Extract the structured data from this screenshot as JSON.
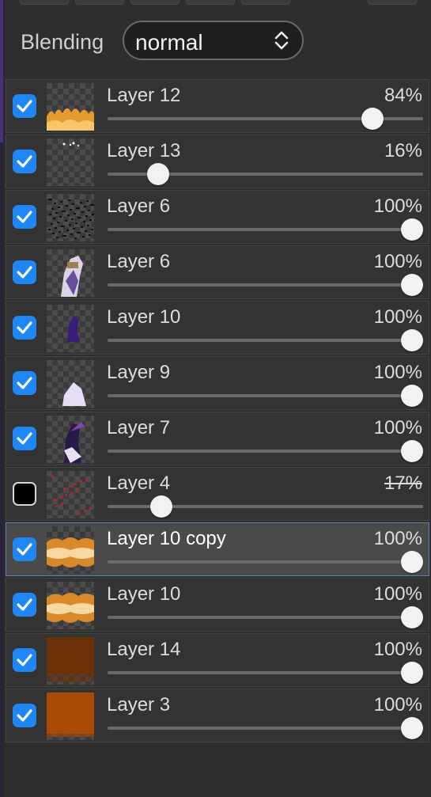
{
  "blending": {
    "label": "Blending",
    "value": "normal"
  },
  "colors": {
    "accent": "#1e86f5",
    "selected_row": "#4a4a4a",
    "selected_border": "#5e7fb6"
  },
  "layers": [
    {
      "name": "Layer 12",
      "opacity_label": "84%",
      "opacity": 0.84,
      "visible": true,
      "struck": false,
      "thumb": "flames-bottom"
    },
    {
      "name": "Layer 13",
      "opacity_label": "16%",
      "opacity": 0.16,
      "visible": true,
      "struck": false,
      "thumb": "white-dots"
    },
    {
      "name": "Layer 6",
      "opacity_label": "100%",
      "opacity": 1.0,
      "visible": true,
      "struck": false,
      "thumb": "dark-speckles"
    },
    {
      "name": "Layer 6",
      "opacity_label": "100%",
      "opacity": 1.0,
      "visible": true,
      "struck": false,
      "thumb": "figure-light"
    },
    {
      "name": "Layer 10",
      "opacity_label": "100%",
      "opacity": 1.0,
      "visible": true,
      "struck": false,
      "thumb": "purple-figure"
    },
    {
      "name": "Layer 9",
      "opacity_label": "100%",
      "opacity": 1.0,
      "visible": true,
      "struck": false,
      "thumb": "lilac-blob"
    },
    {
      "name": "Layer 7",
      "opacity_label": "100%",
      "opacity": 1.0,
      "visible": true,
      "struck": false,
      "thumb": "figure-purple"
    },
    {
      "name": "Layer 4",
      "opacity_label": "17%",
      "opacity": 0.17,
      "visible": false,
      "struck": true,
      "thumb": "red-sketch"
    },
    {
      "name": "Layer 10 copy",
      "opacity_label": "100%",
      "opacity": 1.0,
      "visible": true,
      "struck": false,
      "thumb": "flame-band",
      "selected": true
    },
    {
      "name": "Layer 10",
      "opacity_label": "100%",
      "opacity": 1.0,
      "visible": true,
      "struck": false,
      "thumb": "flame-band"
    },
    {
      "name": "Layer 14",
      "opacity_label": "100%",
      "opacity": 1.0,
      "visible": true,
      "struck": false,
      "thumb": "brown-fill"
    },
    {
      "name": "Layer 3",
      "opacity_label": "100%",
      "opacity": 1.0,
      "visible": true,
      "struck": false,
      "thumb": "orange-fill"
    }
  ]
}
